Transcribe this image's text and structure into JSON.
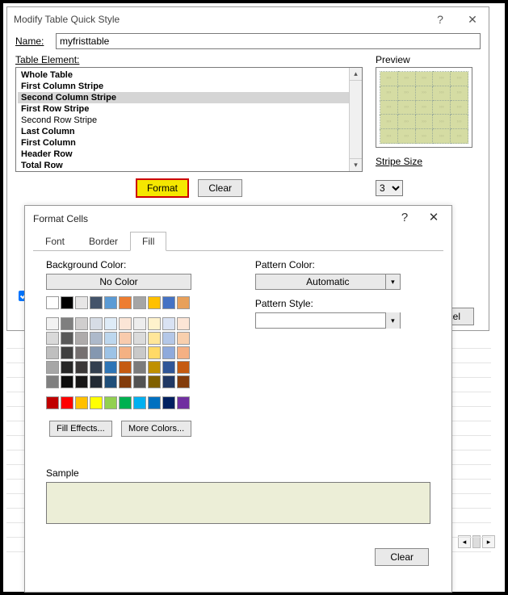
{
  "win1": {
    "title": "Modify Table Quick Style",
    "name_label": "Name:",
    "name_value": "myfristtable",
    "element_label": "Table Element:",
    "elements": [
      {
        "label": "Whole Table",
        "bold": true,
        "selected": false
      },
      {
        "label": "First Column Stripe",
        "bold": true,
        "selected": false
      },
      {
        "label": "Second Column Stripe",
        "bold": true,
        "selected": true
      },
      {
        "label": "First Row Stripe",
        "bold": true,
        "selected": false
      },
      {
        "label": "Second Row Stripe",
        "bold": false,
        "selected": false
      },
      {
        "label": "Last Column",
        "bold": true,
        "selected": false
      },
      {
        "label": "First Column",
        "bold": true,
        "selected": false
      },
      {
        "label": "Header Row",
        "bold": true,
        "selected": false
      },
      {
        "label": "Total Row",
        "bold": true,
        "selected": false
      }
    ],
    "format_btn": "Format",
    "clear_btn": "Clear",
    "preview_label": "Preview",
    "stripe_label": "Stripe Size",
    "stripe_value": "3",
    "cancel_btn": "Cancel"
  },
  "win2": {
    "title": "Format Cells",
    "tabs": {
      "font": "Font",
      "border": "Border",
      "fill": "Fill"
    },
    "active_tab": "Fill",
    "bg_label": "Background Color:",
    "nocolor_btn": "No Color",
    "pcolor_label": "Pattern Color:",
    "pcolor_value": "Automatic",
    "pstyle_label": "Pattern Style:",
    "fill_eff_btn": "Fill Effects...",
    "more_colors_btn": "More Colors...",
    "sample_label": "Sample",
    "sample_color": "#eceed7",
    "clear_btn": "Clear",
    "palette_row1": [
      "#ffffff",
      "#000000",
      "#e7e6e6",
      "#44546a",
      "#5b9bd5",
      "#ed7d31",
      "#a5a5a5",
      "#ffc000",
      "#4472c4",
      "#e8a05a"
    ],
    "palette_block": [
      [
        "#f2f2f2",
        "#7f7f7f",
        "#d0cece",
        "#d6dce5",
        "#deebf7",
        "#fbe5d6",
        "#ededed",
        "#fff2cc",
        "#d9e2f3",
        "#fce5d6"
      ],
      [
        "#d9d9d9",
        "#595959",
        "#aeabab",
        "#adb9ca",
        "#bdd7ee",
        "#f8cbad",
        "#dbdbdb",
        "#ffe699",
        "#b4c7e7",
        "#f8cfad"
      ],
      [
        "#bfbfbf",
        "#404040",
        "#757070",
        "#8497b0",
        "#9dc3e6",
        "#f4b183",
        "#c9c9c9",
        "#ffd966",
        "#8faadc",
        "#f4b083"
      ],
      [
        "#a6a6a6",
        "#262626",
        "#3b3838",
        "#333f50",
        "#2e75b6",
        "#c55a11",
        "#7b7b7b",
        "#bf9000",
        "#2f5597",
        "#c55a11"
      ],
      [
        "#808080",
        "#0d0d0d",
        "#171616",
        "#222a35",
        "#1f4e79",
        "#833c0c",
        "#525252",
        "#806000",
        "#203864",
        "#833c0c"
      ]
    ],
    "palette_std": [
      "#c00000",
      "#ff0000",
      "#ffc000",
      "#ffff00",
      "#92d050",
      "#00b050",
      "#00b0f0",
      "#0070c0",
      "#002060",
      "#7030a0"
    ]
  }
}
